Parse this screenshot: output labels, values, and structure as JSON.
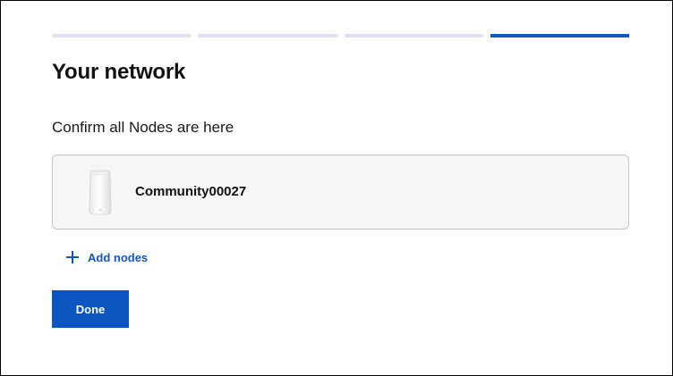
{
  "progress": {
    "total_steps": 4,
    "current_step": 4
  },
  "page": {
    "title": "Your network",
    "subtitle": "Confirm all Nodes are here"
  },
  "nodes": [
    {
      "name": "Community00027",
      "icon": "router-node-icon"
    }
  ],
  "actions": {
    "add_nodes_label": "Add nodes",
    "add_icon": "plus-icon",
    "done_label": "Done"
  },
  "colors": {
    "accent": "#1256c4",
    "progress_inactive": "#dfe3f1",
    "card_bg": "#f6f6f6",
    "card_border": "#c6c6c6"
  }
}
